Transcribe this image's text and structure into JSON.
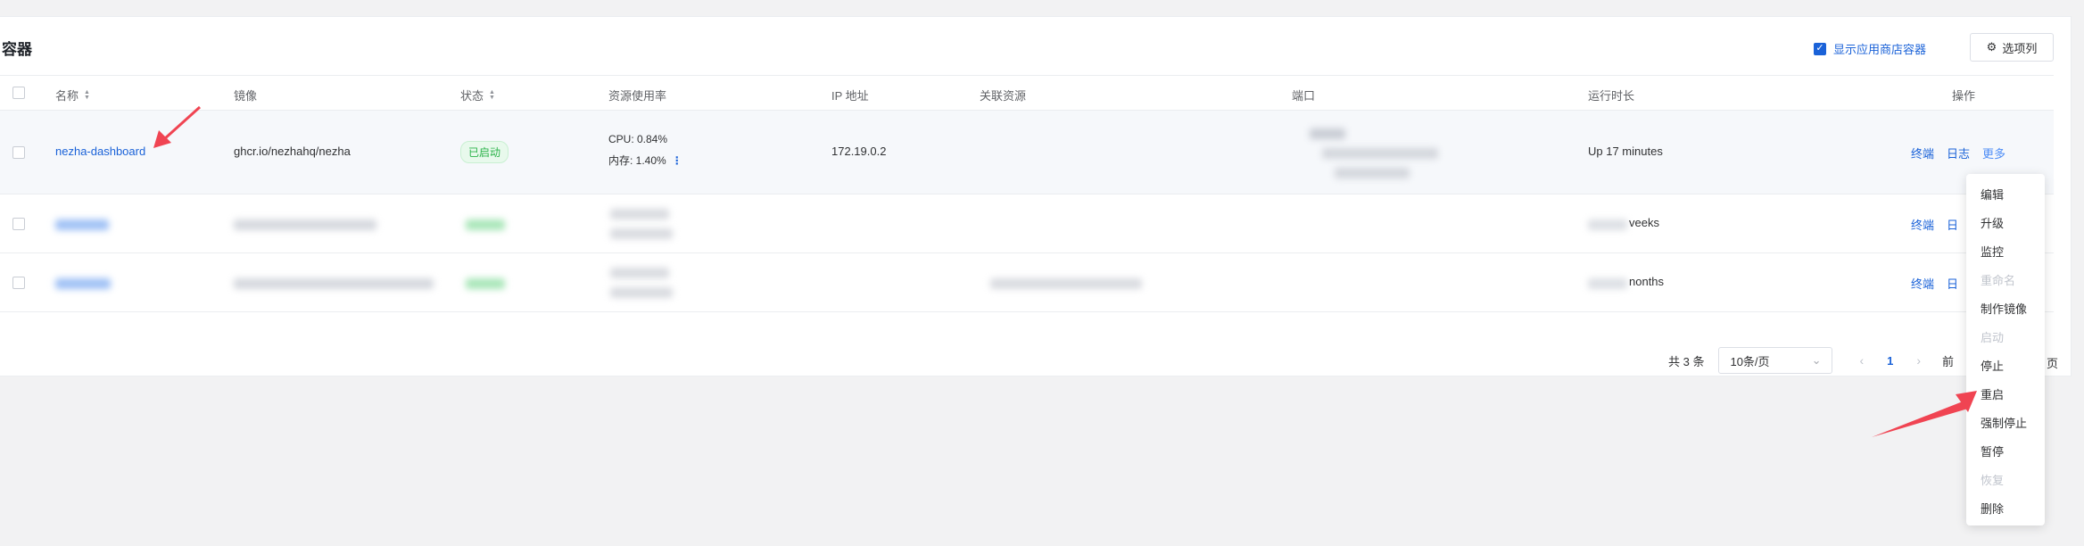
{
  "card": {
    "title": "容器"
  },
  "toolbar": {
    "show_store": "显示应用商店容器",
    "columns_button": "选项列"
  },
  "columns": [
    "名称",
    "镜像",
    "状态",
    "资源使用率",
    "IP 地址",
    "关联资源",
    "端口",
    "运行时长",
    "操作"
  ],
  "rows": [
    {
      "name": "nezha-dashboard",
      "image": "ghcr.io/nezhahq/nezha",
      "status": "已启动",
      "cpu": "CPU: 0.84%",
      "mem": "内存: 1.40%",
      "ip": "172.19.0.2",
      "uptime": "Up 17 minutes",
      "ops": [
        "终端",
        "日志",
        "更多"
      ]
    },
    {
      "uptime_partial": "veeks",
      "ops": [
        "终端",
        "日"
      ]
    },
    {
      "uptime_partial": "nonths",
      "ops": [
        "终端",
        "日"
      ]
    }
  ],
  "pagination": {
    "total": "共 3 条",
    "page_size": "10条/页",
    "current_page": "1",
    "prev_partial": "前",
    "next_partial": "页"
  },
  "dropdown_menu": [
    {
      "label": "编辑",
      "disabled": false
    },
    {
      "label": "升级",
      "disabled": false
    },
    {
      "label": "监控",
      "disabled": false
    },
    {
      "label": "重命名",
      "disabled": true
    },
    {
      "label": "制作镜像",
      "disabled": false
    },
    {
      "label": "启动",
      "disabled": true
    },
    {
      "label": "停止",
      "disabled": false
    },
    {
      "label": "重启",
      "disabled": false
    },
    {
      "label": "强制停止",
      "disabled": false
    },
    {
      "label": "暂停",
      "disabled": false
    },
    {
      "label": "恢复",
      "disabled": true
    },
    {
      "label": "删除",
      "disabled": false
    }
  ],
  "colors": {
    "accent": "#1a62d8",
    "success": "#2bb34a",
    "annotation_arrow": "#f04452"
  }
}
